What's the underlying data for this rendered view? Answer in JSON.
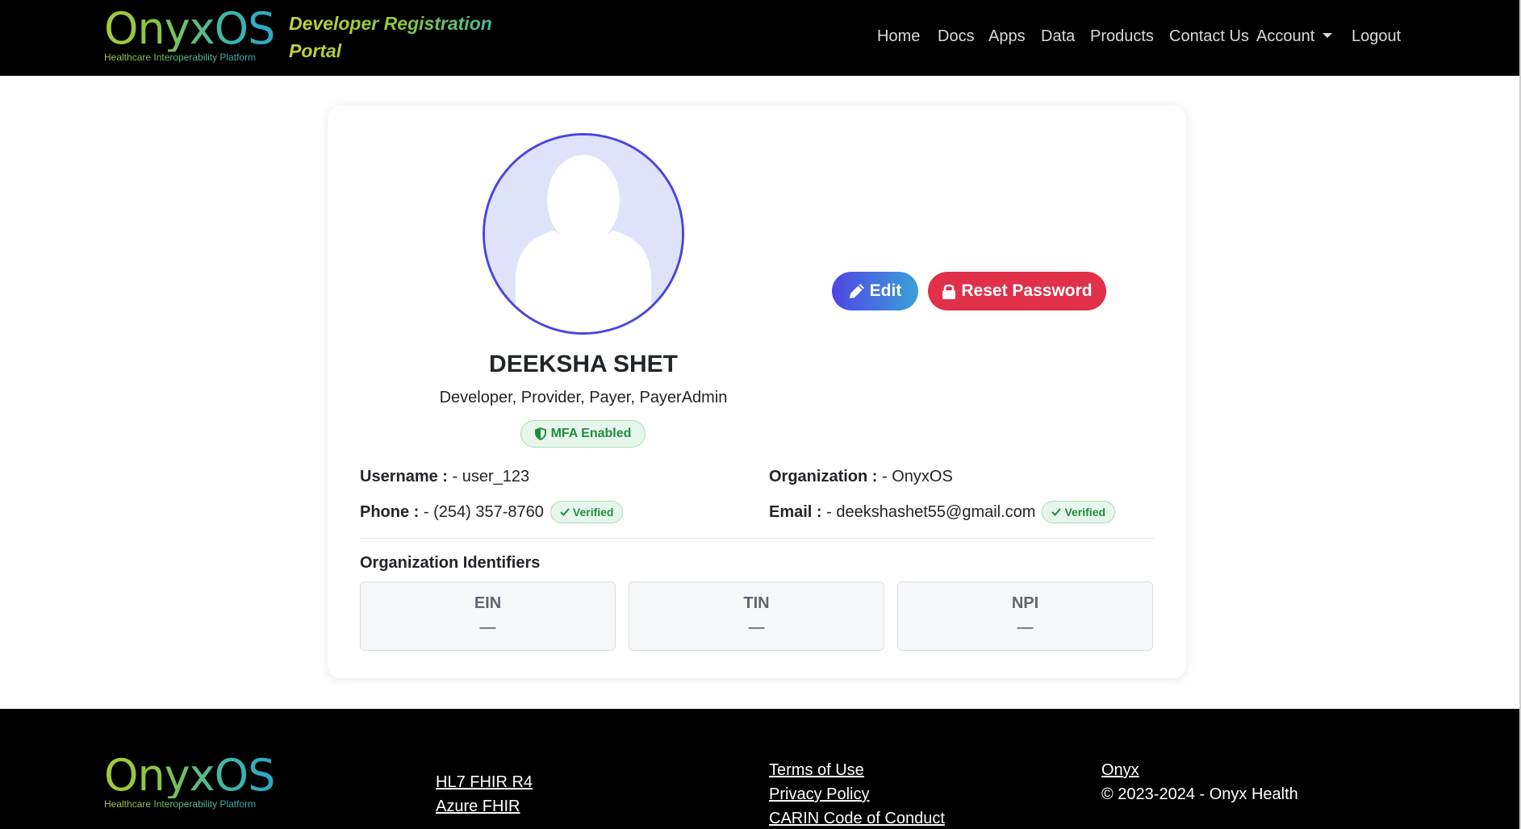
{
  "header": {
    "logo_text": "OnyxOS",
    "logo_tagline": "Healthcare Interoperability Platform",
    "portal_title": "Developer Registration Portal",
    "nav": {
      "home": "Home",
      "docs": "Docs",
      "apps": "Apps",
      "data": "Data",
      "products": "Products",
      "contact": "Contact Us",
      "account": "Account",
      "logout": "Logout"
    }
  },
  "profile": {
    "name": "DEEKSHA SHET",
    "roles": "Developer, Provider, Payer, PayerAdmin",
    "mfa_label": "MFA Enabled",
    "edit_label": "Edit",
    "reset_label": "Reset Password",
    "username_label": "Username :",
    "username_value": " - user_123",
    "organization_label": "Organization :",
    "organization_value": " - OnyxOS",
    "phone_label": "Phone :",
    "phone_value": " - (254) 357-8760",
    "email_label": "Email :",
    "email_value": " - deekshashet55@gmail.com",
    "verified_label": "Verified"
  },
  "identifiers": {
    "title": "Organization Identifiers",
    "items": [
      {
        "label": "EIN",
        "value": "—"
      },
      {
        "label": "TIN",
        "value": "—"
      },
      {
        "label": "NPI",
        "value": "—"
      }
    ]
  },
  "footer": {
    "logo_text": "OnyxOS",
    "logo_tagline": "Healthcare Interoperability Platform",
    "links_col1": [
      "HL7 FHIR R4",
      "Azure FHIR"
    ],
    "links_col2": [
      "Terms of Use",
      "Privacy Policy",
      "CARIN Code of Conduct"
    ],
    "brand_link": "Onyx",
    "copyright": "© 2023-2024 - Onyx Health"
  },
  "colors": {
    "header_bg": "#000000",
    "edit_gradient_start": "#4f46e5",
    "edit_gradient_end": "#3aa0d8",
    "reset_bg": "#e0304a",
    "verified_green": "#1e8e3e",
    "avatar_border": "#4b45e0"
  },
  "icons": {
    "edit": "pencil-icon",
    "reset": "lock-icon",
    "mfa": "shield-icon",
    "verified": "check-icon",
    "account": "caret-down-icon"
  }
}
